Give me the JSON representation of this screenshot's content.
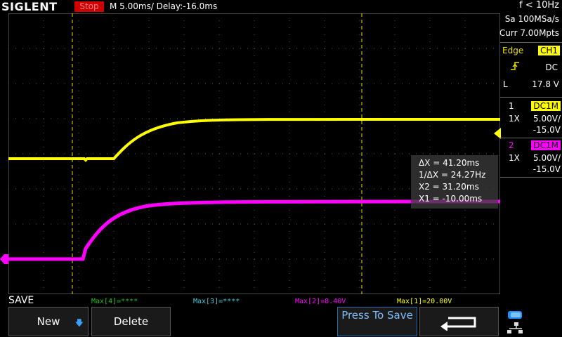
{
  "header": {
    "brand": "SIGLENT",
    "run_state": "Stop",
    "timebase": "M 5.00ms/ Delay:-16.0ms",
    "freq_counter": "f < 10Hz"
  },
  "acquisition": {
    "sample_rate": "Sa 100MSa/s",
    "memory_depth": "Curr 7.00Mpts"
  },
  "trigger": {
    "type": "Edge",
    "source": "CH1",
    "coupling": "DC",
    "level_prefix": "L",
    "level": "17.8 V"
  },
  "channels": [
    {
      "num": "1",
      "coupling": "DC1M",
      "probe": "1X",
      "scale": "5.00V/",
      "offset": "-15.0V",
      "color": "#ffff00"
    },
    {
      "num": "2",
      "coupling": "DC1M",
      "probe": "1X",
      "scale": "5.00V/",
      "offset": "-15.0V",
      "color": "#ff00ff"
    }
  ],
  "cursors": {
    "dx": "ΔX = 41.20ms",
    "inv_dx": "1/ΔX = 24.27Hz",
    "x2": "X2 = 31.20ms",
    "x1": "X1 = -10.00ms"
  },
  "measurements": {
    "max4": "Max[4]=****",
    "max3": "Max[3]=****",
    "max2": "Max[2]=8.40V",
    "max1": "Max[1]=20.00V"
  },
  "menu": {
    "title": "SAVE",
    "new_label": "New",
    "delete_label": "Delete",
    "press_to_save": "Press To Save",
    "back_icon": "return-arrow-icon",
    "usb_icon": "usb-network-icon"
  },
  "colors": {
    "ch1": "#ffff00",
    "ch2": "#ff00ff",
    "stop": "#d00000",
    "grid": "#5a5a5a"
  }
}
